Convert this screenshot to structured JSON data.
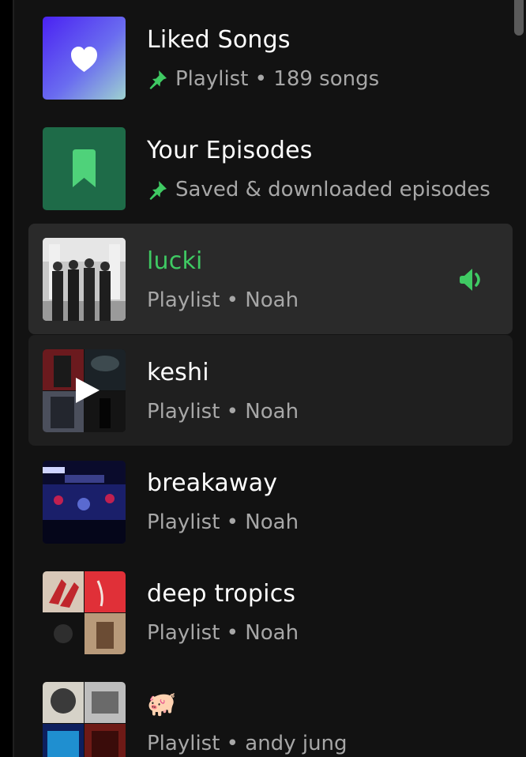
{
  "library": {
    "items": [
      {
        "title": "Liked Songs",
        "subtitle": "Playlist • 189 songs",
        "pinned": true,
        "thumb_icon": "heart-icon"
      },
      {
        "title": "Your Episodes",
        "subtitle": "Saved & downloaded episodes",
        "pinned": true,
        "thumb_icon": "bookmark-icon"
      },
      {
        "title": "lucki",
        "subtitle": "Playlist • Noah",
        "playing": true,
        "status_icon": "speaker-icon"
      },
      {
        "title": "keshi",
        "subtitle": "Playlist • Noah",
        "hover_icon": "play-icon"
      },
      {
        "title": "breakaway",
        "subtitle": "Playlist • Noah"
      },
      {
        "title": "deep tropics",
        "subtitle": "Playlist • Noah"
      },
      {
        "title": "🐖",
        "subtitle": "Playlist • andy jung"
      }
    ]
  },
  "colors": {
    "background": "#121212",
    "active_row": "#2a2a2a",
    "playing_green": "#3fca63",
    "secondary_text": "#a7a7a7"
  }
}
